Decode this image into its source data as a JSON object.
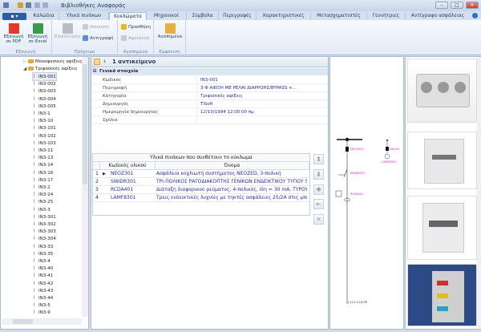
{
  "window": {
    "title": "Βιβλιοθήκες Αναφοράς",
    "minimize": "–",
    "maximize": "□",
    "close": "✕"
  },
  "tabs": [
    "Καλώδια",
    "Υλικά πινάκων",
    "Κυκλώματα",
    "Μηχανικοί",
    "Σύμβολα",
    "Περιγραφές",
    "Χαρακτηριστικές",
    "Μετασχηματιστές",
    "Γεννήτριες",
    "Αντίγραφα ασφάλειας"
  ],
  "active_tab": "Κυκλώματα",
  "ribbon": {
    "export": {
      "label": "Εξαγωγή",
      "pdf": "Εξαγωγή σε PDF",
      "excel": "Εξαγωγή σε Excel"
    },
    "clipboard": {
      "label": "Πρόχειρο",
      "paste": "Επικόλληση",
      "cut": "Αποκοπή",
      "copy": "Αντιγραφή"
    },
    "favorites": {
      "label": "Αγαπημένα",
      "add": "Προσθήκη",
      "remove": "Αφαίρεση"
    },
    "view": {
      "label": "Εμφάνιση",
      "favorites": "Αγαπημένα"
    }
  },
  "tree": {
    "folders": [
      "Μονοφασικές αφίξεις",
      "Τριφασικές αφίξεις"
    ],
    "items": [
      "IN3-001",
      "IN3-002",
      "IN3-003",
      "IN3-004",
      "IN3-005",
      "IN3-1",
      "IN3-10",
      "IN3-101",
      "IN3-102",
      "IN3-103",
      "IN3-11",
      "IN3-13",
      "IN3-14",
      "IN3-16",
      "IN3-17",
      "IN3-2",
      "IN3-24",
      "IN3-25",
      "IN3-3",
      "IN3-301",
      "IN3-302",
      "IN3-303",
      "IN3-304",
      "IN3-33",
      "IN3-35",
      "IN3-4",
      "IN3-40",
      "IN3-41",
      "IN3-42",
      "IN3-43",
      "IN3-44",
      "IN3-5",
      "IN3-9"
    ],
    "selected": "IN3-001"
  },
  "properties": {
    "count": "1 αντικείμενο",
    "group": "Γενικά στοιχεία",
    "rows": [
      {
        "k": "Κωδικός",
        "v": "IN3-001"
      },
      {
        "k": "Περιγραφή",
        "v": "3-Φ ΑΦΙΞΗ ΜΕ ΡΕΛΑΙ ΔΙΑΡΡΟΗΣ/BYPASS +..."
      },
      {
        "k": "Κατηγορία",
        "v": "Τριφασικές αφίξεις"
      },
      {
        "k": "Δημιουργός",
        "v": "TiSoft"
      },
      {
        "k": "Ημερομηνία δημιουργίας",
        "v": "12/10/1994 12:00:00 πμ"
      },
      {
        "k": "Σχόλια",
        "v": ""
      }
    ]
  },
  "materials": {
    "caption": "Υλικά πινάκων που συνθέτουν το κύκλωμα",
    "headers": [
      "Κωδικός υλικού",
      "Όνομα"
    ],
    "rows": [
      {
        "n": "1",
        "code": "NEOZ301",
        "name": "Ασφάλεια κοχλιωτή συστήματος NEOZED, 3-πολική"
      },
      {
        "n": "2",
        "code": "SWIDR301",
        "name": "ΤΡΙ-ΠΟΛΙΚΟΣ ΡΑΓΟΔΙΑΚΟΠΤΗΣ ΓΕΝΙΚΩΝ ΕΝΔΕΙΚΤΙΚΟΥ ΤΥΠΟΥ 5T..."
      },
      {
        "n": "3",
        "code": "RCDA401",
        "name": "Διάταξη διαφορικού ρεύματος, 4-πολικός, Ιδη = 30 mA, ΤΥΡΟΥ Α"
      },
      {
        "n": "4",
        "code": "LAMF8301",
        "name": "Τρεις ενδεικτικές λυχνίες με τηκτές ασφάλειες 25/2A στις μπάρες"
      }
    ]
  },
  "diagram": {
    "labels": [
      "NEOZ301",
      "SWIDR301",
      "RCDA401",
      "NEOZA",
      "LAMF8301",
      "L1,L2,L3,N,PE"
    ]
  },
  "colors": {
    "accent": "#2b5eaa",
    "link": "#2a2aa0",
    "magenta": "#d020d0"
  }
}
